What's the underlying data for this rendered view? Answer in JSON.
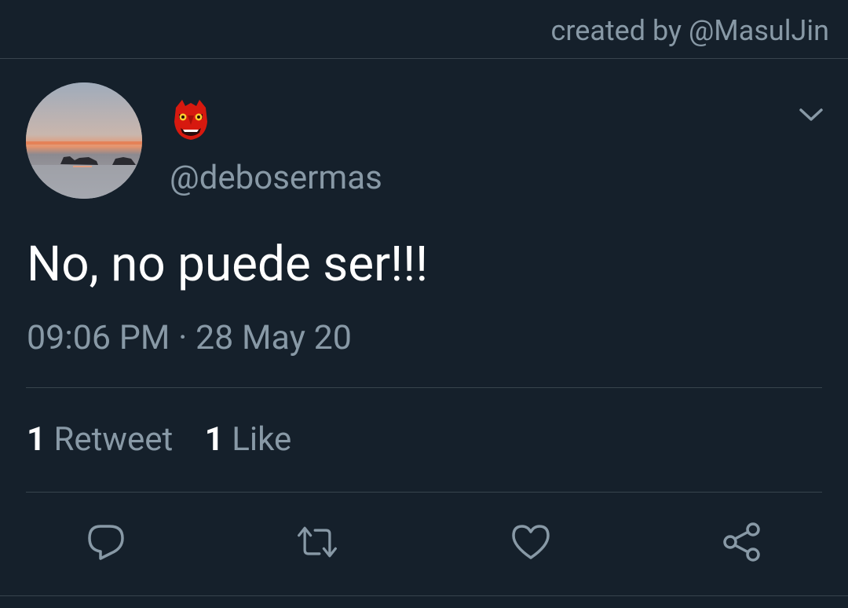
{
  "header": {
    "credit": "created by @MasulJin"
  },
  "tweet": {
    "display_name_icon": "red-tengu-mask-emoji",
    "handle": "@debosermas",
    "text": "No, no puede ser!!!",
    "timestamp": "09:06 PM · 28 May 20",
    "retweet_count": "1",
    "retweet_label": "Retweet",
    "like_count": "1",
    "like_label": "Like"
  },
  "actions": [
    {
      "name": "reply",
      "icon": "reply-icon"
    },
    {
      "name": "retweet",
      "icon": "retweet-icon"
    },
    {
      "name": "like",
      "icon": "heart-icon"
    },
    {
      "name": "share",
      "icon": "share-icon"
    }
  ],
  "colors": {
    "background": "#15202b",
    "secondary_text": "#8899a6",
    "primary_text": "#ffffff",
    "divider": "#38444d"
  }
}
